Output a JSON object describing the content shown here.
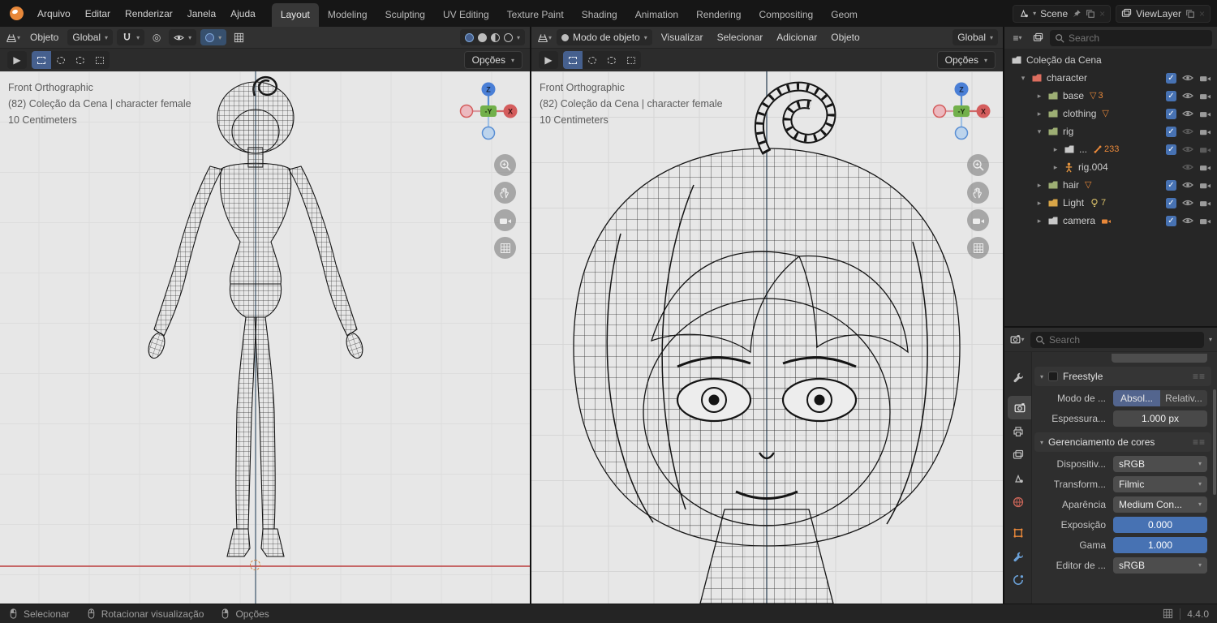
{
  "topbar": {
    "menus": [
      "Arquivo",
      "Editar",
      "Renderizar",
      "Janela",
      "Ajuda"
    ],
    "tabs": [
      "Layout",
      "Modeling",
      "Sculpting",
      "UV Editing",
      "Texture Paint",
      "Shading",
      "Animation",
      "Rendering",
      "Compositing",
      "Geom"
    ],
    "active_tab": "Layout",
    "scene_label": "Scene",
    "viewlayer_label": "ViewLayer"
  },
  "viewport_overlay": {
    "line1": "Front Orthographic",
    "line2": "(82) Coleção da Cena | character female",
    "line3": "10 Centimeters"
  },
  "gizmo": {
    "z": "Z",
    "neg_y": "-Y",
    "x": "X"
  },
  "viewport_left": {
    "object_menu": "Objeto",
    "orientation": "Global",
    "options_label": "Opções"
  },
  "viewport_right": {
    "mode": "Modo de objeto",
    "menus": [
      "Visualizar",
      "Selecionar",
      "Adicionar",
      "Objeto"
    ],
    "orientation": "Global",
    "options_label": "Opções"
  },
  "outliner": {
    "search_placeholder": "Search",
    "scene_collection": "Coleção da Cena",
    "rows": [
      {
        "label": "character"
      },
      {
        "label": "base",
        "count": "3"
      },
      {
        "label": "clothing"
      },
      {
        "label": "rig"
      },
      {
        "label": "...",
        "count": "233"
      },
      {
        "label": "rig.004"
      },
      {
        "label": "hair"
      },
      {
        "label": "Light",
        "count": "7"
      },
      {
        "label": "camera"
      }
    ]
  },
  "properties": {
    "search_placeholder": "Search",
    "freestyle_label": "Freestyle",
    "mode_label": "Modo de ...",
    "mode_absolute": "Absol...",
    "mode_relative": "Relativ...",
    "thickness_label": "Espessura...",
    "thickness_value": "1.000 px",
    "cm_title": "Gerenciamento de cores",
    "device_label": "Dispositiv...",
    "device_value": "sRGB",
    "transform_label": "Transform...",
    "transform_value": "Filmic",
    "look_label": "Aparência",
    "look_value": "Medium Con...",
    "exposure_label": "Exposição",
    "exposure_value": "0.000",
    "gamma_label": "Gama",
    "gamma_value": "1.000",
    "editor_label": "Editor de ...",
    "editor_value": "sRGB"
  },
  "statusbar": {
    "items": [
      "Selecionar",
      "Rotacionar visualização",
      "Opções"
    ],
    "version": "4.4.0"
  },
  "colors": {
    "accent_blue": "#4772b3",
    "badge_orange": "#e8883a",
    "axis_x_red": "#d45d5d",
    "axis_y_green": "#72b04b",
    "axis_z_blue": "#4a7fd6"
  }
}
